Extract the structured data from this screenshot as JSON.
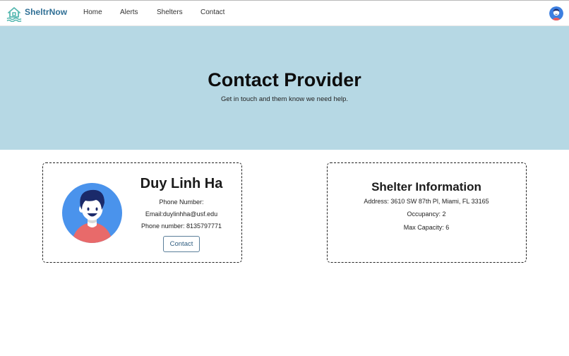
{
  "brand": {
    "name": "SheltrNow"
  },
  "nav": {
    "home": "Home",
    "alerts": "Alerts",
    "shelters": "Shelters",
    "contact": "Contact"
  },
  "hero": {
    "title": "Contact Provider",
    "subtitle": "Get in touch and them know we need help."
  },
  "provider": {
    "name": "Duy Linh Ha",
    "phone_label": "Phone Number:",
    "email_text": "Email:duylinhha@usf.edu",
    "phone_text": "Phone number: 8135797771",
    "contact_button": "Contact"
  },
  "shelter": {
    "title": "Shelter Information",
    "address": "Address: 3610 SW 87th Pl, Miami, FL 33165",
    "occupancy": "Occupancy: 2",
    "capacity": "Max Capacity: 6"
  },
  "colors": {
    "hero_bg": "#b6d8e4",
    "brand": "#2f6f95",
    "logo_teal": "#56b8b0"
  },
  "icons": {
    "logo": "house-water-icon",
    "user": "user-avatar-icon"
  }
}
